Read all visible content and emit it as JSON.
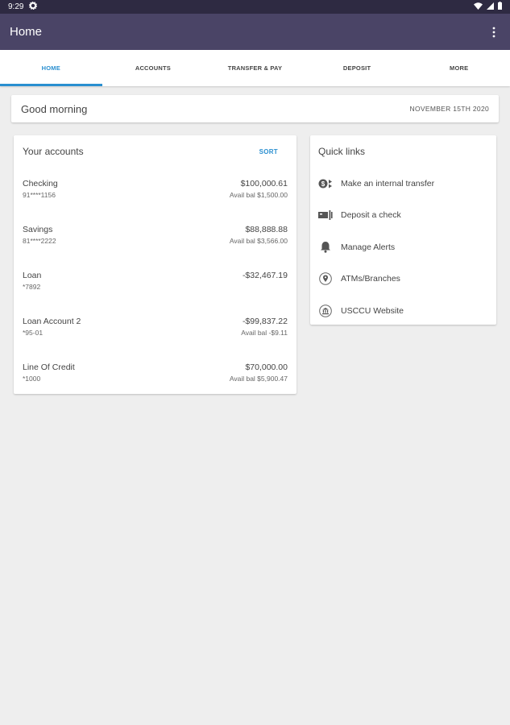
{
  "status_bar": {
    "time": "9:29"
  },
  "app_bar": {
    "title": "Home"
  },
  "tabs": [
    {
      "label": "HOME",
      "active": true
    },
    {
      "label": "ACCOUNTS"
    },
    {
      "label": "TRANSFER & PAY"
    },
    {
      "label": "DEPOSIT"
    },
    {
      "label": "MORE"
    }
  ],
  "greeting": {
    "text": "Good morning",
    "date": "NOVEMBER 15TH 2020"
  },
  "accounts": {
    "title": "Your accounts",
    "sort_label": "SORT",
    "items": [
      {
        "name": "Checking",
        "number": "91****1156",
        "balance": "$100,000.61",
        "avail": "Avail bal $1,500.00"
      },
      {
        "name": "Savings",
        "number": "81****2222",
        "balance": "$88,888.88",
        "avail": "Avail bal $3,566.00"
      },
      {
        "name": "Loan",
        "number": "*7892",
        "balance": "-$32,467.19",
        "avail": ""
      },
      {
        "name": "Loan Account 2",
        "number": "*95-01",
        "balance": "-$99,837.22",
        "avail": "Avail bal -$9.11"
      },
      {
        "name": "Line Of Credit",
        "number": "*1000",
        "balance": "$70,000.00",
        "avail": "Avail bal $5,900.47"
      }
    ]
  },
  "quick_links": {
    "title": "Quick links",
    "items": [
      {
        "label": "Make an internal transfer",
        "icon": "transfer-icon"
      },
      {
        "label": "Deposit a check",
        "icon": "check-deposit-icon"
      },
      {
        "label": "Manage Alerts",
        "icon": "bell-icon"
      },
      {
        "label": "ATMs/Branches",
        "icon": "location-pin-icon"
      },
      {
        "label": "USCCU Website",
        "icon": "bank-icon"
      }
    ]
  },
  "colors": {
    "app_bar": "#4a4466",
    "status_bar": "#2e2a42",
    "accent": "#2a8fd0",
    "background": "#eeeeee"
  }
}
